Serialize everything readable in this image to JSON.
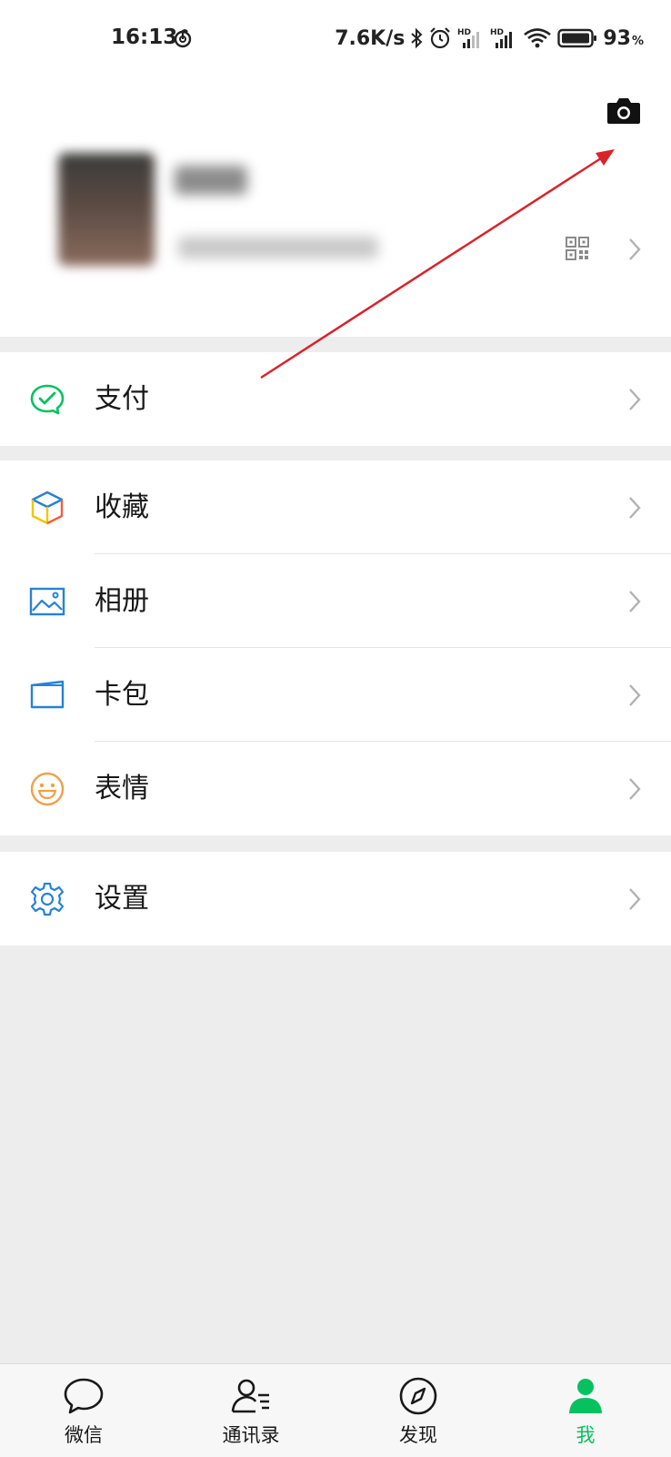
{
  "status_bar": {
    "time": "16:13",
    "net_speed": "7.6K/s",
    "battery": "93",
    "battery_unit": "%"
  },
  "profile": {
    "nickname": "",
    "wechat_id": ""
  },
  "menu_groups": [
    {
      "items": [
        {
          "label": "支付",
          "icon": "wechat-pay-icon",
          "color": "#07c160"
        }
      ]
    },
    {
      "items": [
        {
          "label": "收藏",
          "icon": "favorites-cube-icon",
          "color": "#f5a623"
        },
        {
          "label": "相册",
          "icon": "album-picture-icon",
          "color": "#2782d7"
        },
        {
          "label": "卡包",
          "icon": "card-wallet-icon",
          "color": "#2782d7"
        },
        {
          "label": "表情",
          "icon": "emoji-smile-icon",
          "color": "#f0a04b"
        }
      ]
    },
    {
      "items": [
        {
          "label": "设置",
          "icon": "settings-gear-icon",
          "color": "#2782d7"
        }
      ]
    }
  ],
  "tabs": [
    {
      "label": "微信",
      "icon": "chat-bubble-icon"
    },
    {
      "label": "通讯录",
      "icon": "contacts-icon"
    },
    {
      "label": "发现",
      "icon": "compass-icon"
    },
    {
      "label": "我",
      "icon": "me-person-icon",
      "active": true
    }
  ],
  "colors": {
    "accent": "#07c160",
    "background": "#ededed",
    "annotation_arrow": "#d9232b"
  }
}
